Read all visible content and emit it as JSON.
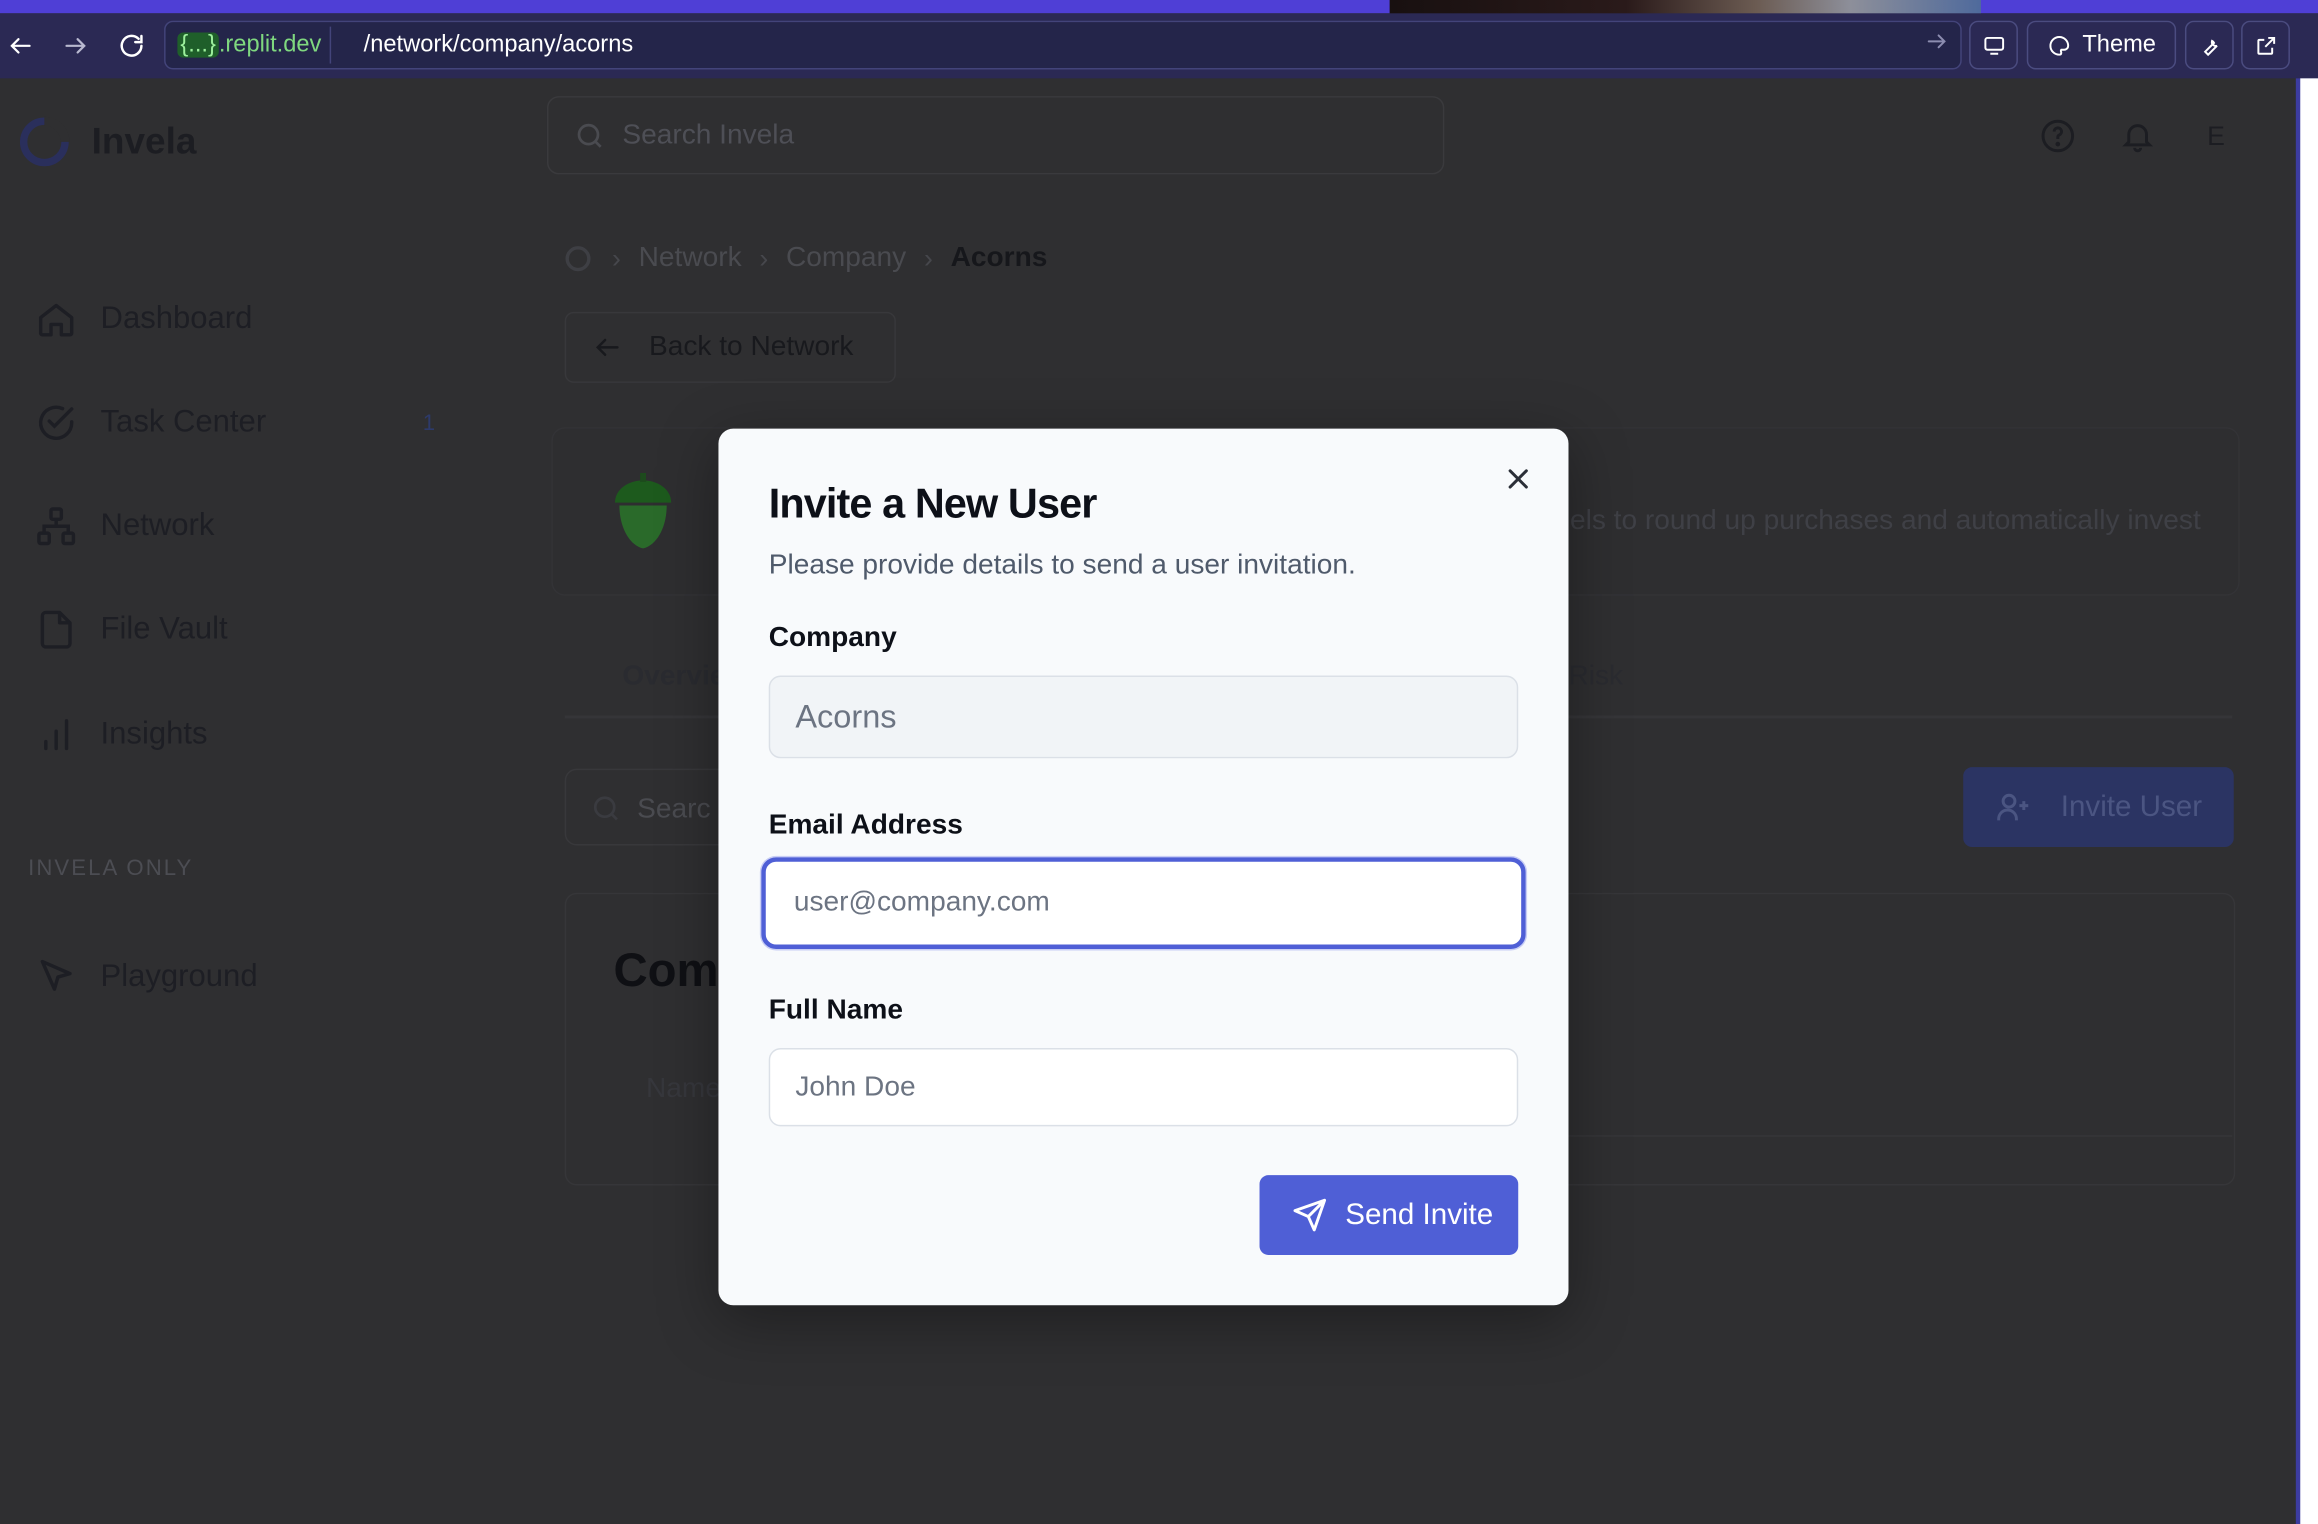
{
  "browser": {
    "domain_brace": "{...}",
    "domain_suffix": ".replit.dev",
    "url_path": "/network/company/acorns",
    "theme_label": "Theme"
  },
  "app": {
    "name": "Invela",
    "search_placeholder": "Search Invela",
    "avatar_initial": "E"
  },
  "sidebar": {
    "items": [
      {
        "label": "Dashboard",
        "icon": "home-icon"
      },
      {
        "label": "Task Center",
        "icon": "check-circle-icon",
        "badge": "1"
      },
      {
        "label": "Network",
        "icon": "network-icon"
      },
      {
        "label": "File Vault",
        "icon": "file-icon"
      },
      {
        "label": "Insights",
        "icon": "bar-chart-icon"
      }
    ],
    "section_label": "INVELA ONLY",
    "admin_items": [
      {
        "label": "Playground",
        "icon": "cursor-icon"
      }
    ]
  },
  "breadcrumb": {
    "items": [
      "Network",
      "Company",
      "Acorns"
    ]
  },
  "back_button": "Back to Network",
  "company": {
    "description_fragment": "els to round up purchases and automatically invest",
    "tab_fragment_left": "Overvie",
    "tab_fragment_right": "Risk"
  },
  "users_section": {
    "search_fragment": "Searc",
    "invite_button": "Invite User",
    "title_fragment": "Com",
    "column_fragment": "Name"
  },
  "modal": {
    "title": "Invite a New User",
    "description": "Please provide details to send a user invitation.",
    "company_label": "Company",
    "company_value": "Acorns",
    "email_label": "Email Address",
    "email_placeholder": "user@company.com",
    "name_label": "Full Name",
    "name_placeholder": "John Doe",
    "submit_label": "Send Invite"
  },
  "colors": {
    "accent": "#4f5fd6",
    "overlay_bg": "#2f2f31",
    "browser_bar": "#2b2954"
  }
}
